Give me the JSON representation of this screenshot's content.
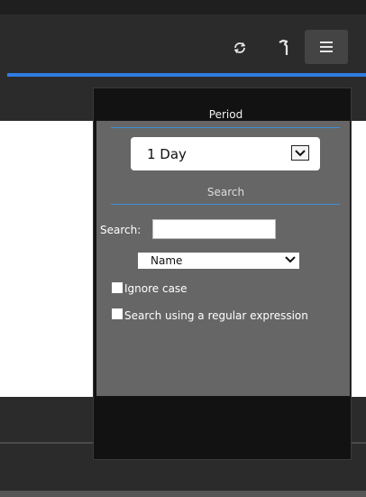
{
  "header": {
    "icons": [
      "refresh-icon",
      "wrench-icon",
      "hamburger-menu-icon"
    ]
  },
  "panel": {
    "period": {
      "title": "Period",
      "selected": "1 Day"
    },
    "search": {
      "title": "Search",
      "label": "Search:",
      "value": "",
      "field_selected": "Name",
      "ignore_case_label": "Ignore case",
      "regex_label": "Search using a regular expression"
    }
  },
  "colors": {
    "accent": "#2f7de1",
    "header_bg": "#2b2b2b",
    "panel_bg": "#666666",
    "panel_frame": "#121212"
  }
}
